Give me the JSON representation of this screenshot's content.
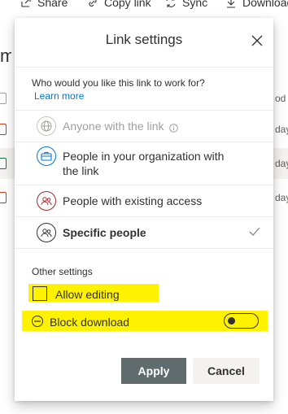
{
  "toolbar": {
    "share_label": "Share",
    "copy_link_label": "Copy link",
    "sync_label": "Sync",
    "download_label": "Download"
  },
  "background": {
    "page_fragment": "m",
    "column_fragment": "od",
    "row_fragments": [
      "day",
      "day",
      "day"
    ]
  },
  "dialog": {
    "title": "Link settings",
    "question": "Who would you like this link to work for?",
    "learn_more": "Learn more",
    "options": [
      {
        "label": "Anyone with the link",
        "icon": "globe-icon",
        "disabled": true,
        "info_icon": "info-icon"
      },
      {
        "label": "People in your organization with the link",
        "icon": "briefcase-icon",
        "disabled": false
      },
      {
        "label": "People with existing access",
        "icon": "people-icon",
        "disabled": false
      },
      {
        "label": "Specific people",
        "icon": "people-icon",
        "selected": true
      }
    ],
    "other_settings_title": "Other settings",
    "allow_editing_label": "Allow editing",
    "allow_editing_checked": false,
    "block_download_label": "Block download",
    "block_download_on": false,
    "apply_label": "Apply",
    "cancel_label": "Cancel"
  },
  "colors": {
    "highlight": "#fff200",
    "link": "#0078d4",
    "apply_bg": "#5f6b6d",
    "org_icon": "#0078d4",
    "existing_icon": "#a4262c",
    "checkmark": "#8a8886"
  }
}
